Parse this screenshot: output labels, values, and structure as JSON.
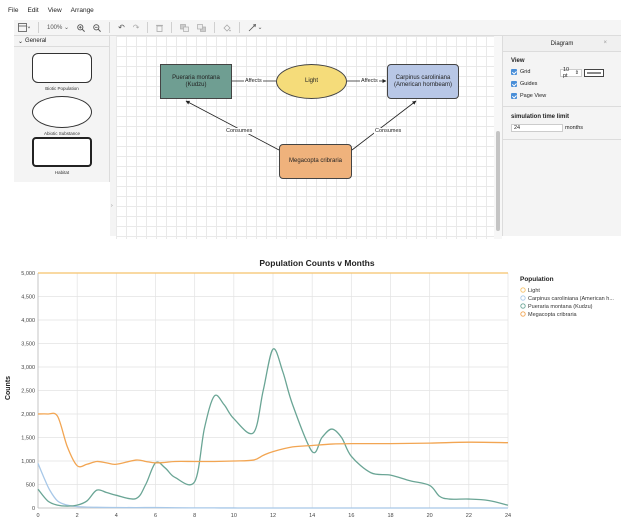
{
  "menu": {
    "items": [
      "File",
      "Edit",
      "View",
      "Arrange"
    ]
  },
  "toolbar": {
    "zoom": "100%",
    "undo": "↶",
    "redo": "↷"
  },
  "sidebar": {
    "section": "General",
    "shapes": [
      {
        "label": "Biotic Population"
      },
      {
        "label": "Abiotic Substance"
      },
      {
        "label": "Habitat"
      }
    ]
  },
  "diagram": {
    "nodes": {
      "kudzu": "Pueraria montana\n(Kudzu)",
      "light": "Light",
      "hornbeam": "Carpinus caroliniana\n(American hornbeam)",
      "megacopta": "Megacopta cribraria"
    },
    "edges": {
      "affects_left": "Affects",
      "affects_right": "Affects",
      "consumes_left": "Consumes",
      "consumes_right": "Consumes"
    },
    "colors": {
      "kudzu": "#6f9e92",
      "light": "#f5dc7a",
      "hornbeam": "#b8c7e6",
      "megacopta": "#efb27c"
    }
  },
  "panel": {
    "title": "Diagram",
    "view_label": "View",
    "grid_label": "Grid",
    "grid_size": "10 pt",
    "guides_label": "Guides",
    "page_view_label": "Page View",
    "sim_label": "simulation time limit",
    "sim_value": "24",
    "sim_unit": "months"
  },
  "chart_data": {
    "type": "line",
    "title": "Population Counts v Months",
    "xlabel": "",
    "ylabel": "Counts",
    "xlim": [
      0,
      24
    ],
    "ylim": [
      0,
      5000
    ],
    "xticks": [
      0,
      2,
      4,
      6,
      8,
      10,
      12,
      14,
      16,
      18,
      20,
      22,
      24
    ],
    "yticks": [
      0,
      500,
      1000,
      1500,
      2000,
      2500,
      3000,
      3500,
      4000,
      4500,
      5000
    ],
    "ytick_labels": [
      "0",
      "500",
      "1,000",
      "1,500",
      "2,000",
      "2,500",
      "3,000",
      "3,500",
      "4,000",
      "4,500",
      "5,000"
    ],
    "grid": true,
    "legend_title": "Population",
    "legend_position": "right",
    "series": [
      {
        "name": "Light",
        "color": "#f5c26b",
        "x": [
          0,
          24
        ],
        "y": [
          5000,
          5000
        ]
      },
      {
        "name": "Carpinus caroliniana (American h...",
        "color": "#a8c8e8",
        "x": [
          0,
          0.3,
          0.6,
          1,
          1.5,
          2,
          3,
          4,
          5,
          6,
          7,
          8,
          9,
          10,
          12,
          24
        ],
        "y": [
          950,
          650,
          380,
          150,
          60,
          30,
          15,
          10,
          8,
          10,
          5,
          3,
          2,
          1,
          0,
          0
        ]
      },
      {
        "name": "Pueraria montana (Kudzu)",
        "color": "#6aa595",
        "x": [
          0,
          0.5,
          1,
          1.5,
          2,
          2.5,
          3,
          3.5,
          4,
          5,
          5.5,
          6,
          6.5,
          7,
          8,
          8.5,
          9,
          9.5,
          10,
          11,
          11.5,
          12,
          12.5,
          13,
          14,
          14.5,
          15,
          15.5,
          16,
          17,
          18,
          19,
          20,
          20.5,
          21,
          22,
          23,
          24
        ],
        "y": [
          400,
          150,
          60,
          40,
          60,
          150,
          380,
          330,
          270,
          200,
          500,
          960,
          850,
          650,
          560,
          1700,
          2380,
          2200,
          1900,
          1600,
          2500,
          3380,
          2900,
          2200,
          1200,
          1500,
          1680,
          1500,
          1100,
          750,
          700,
          580,
          480,
          250,
          190,
          190,
          160,
          60
        ]
      },
      {
        "name": "Megacopta cribraria",
        "color": "#f2a552",
        "x": [
          0,
          0.5,
          1,
          1.5,
          2,
          2.5,
          3,
          3.5,
          4,
          5,
          5.5,
          6,
          6.5,
          7,
          8,
          9,
          10,
          11,
          11.5,
          12,
          13,
          14,
          15,
          16,
          18,
          20,
          22,
          24
        ],
        "y": [
          2000,
          2000,
          1950,
          1300,
          900,
          930,
          990,
          960,
          930,
          1020,
          990,
          960,
          970,
          990,
          990,
          990,
          1000,
          1020,
          1120,
          1200,
          1300,
          1330,
          1360,
          1370,
          1370,
          1380,
          1400,
          1390
        ]
      }
    ]
  }
}
